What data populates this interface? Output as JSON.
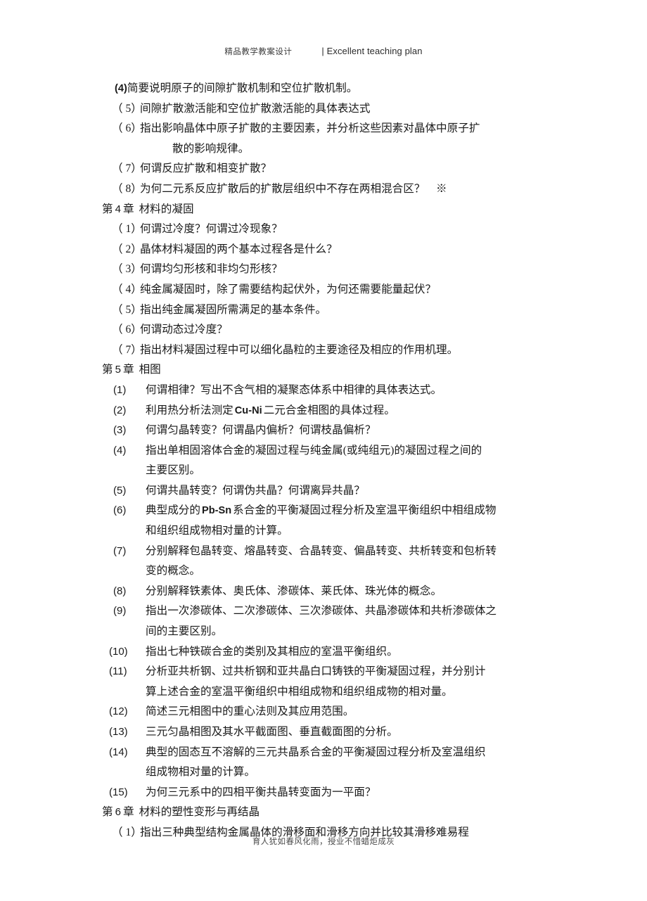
{
  "header": {
    "chinese": "精品教学教案设计",
    "separator_and_english": "| Excellent teaching plan"
  },
  "footer": {
    "motto": "育人犹如春风化雨，授业不惜蜡炬成灰"
  },
  "content": {
    "chapter3_tail": {
      "items": [
        {
          "marker": "(4)",
          "text": "简要说明原子的间隙扩散机制和空位扩散机制。"
        },
        {
          "marker": "（ 5）",
          "text": "间隙扩散激活能和空位扩散激活能的具体表达式"
        },
        {
          "marker": "（ 6）",
          "text": "指出影响晶体中原子扩散的主要因素，并分析这些因素对晶体中原子扩",
          "cont": "散的影响规律。"
        },
        {
          "marker": "（ 7）",
          "text": "何谓反应扩散和相变扩散？"
        },
        {
          "marker": "（ 8）",
          "text": "为何二元系反应扩散后的扩散层组织中不存在两相混合区？　※"
        }
      ]
    },
    "chapter4": {
      "prefix": "第",
      "number": "4",
      "suffix": "章",
      "title": "材料的凝固",
      "items": [
        {
          "marker": "（ 1）",
          "text": "何谓过冷度？何谓过冷现象？"
        },
        {
          "marker": "（ 2）",
          "text": "晶体材料凝固的两个基本过程各是什么？"
        },
        {
          "marker": "（ 3）",
          "text": "何谓均匀形核和非均匀形核？"
        },
        {
          "marker": "（ 4）",
          "text": "纯金属凝固时，除了需要结构起伏外，为何还需要能量起伏？"
        },
        {
          "marker": "（ 5）",
          "text": "指出纯金属凝固所需满足的基本条件。"
        },
        {
          "marker": "（ 6）",
          "text": "何谓动态过冷度？"
        },
        {
          "marker": "（ 7）",
          "text": "指出材料凝固过程中可以细化晶粒的主要途径及相应的作用机理。"
        }
      ]
    },
    "chapter5": {
      "prefix": "第",
      "number": "5",
      "suffix": "章",
      "title": "相图",
      "items": [
        {
          "marker": "(1)",
          "text": "何谓相律？写出不含气相的凝聚态体系中相律的具体表达式。"
        },
        {
          "marker": "(2)",
          "text_before": "利用热分析法测定",
          "latin": "Cu-Ni",
          "text_after": "二元合金相图的具体过程。"
        },
        {
          "marker": "(3)",
          "text": "何谓匀晶转变？何谓晶内偏析？何谓枝晶偏析？"
        },
        {
          "marker": "(4)",
          "text": "指出单相固溶体合金的凝固过程与纯金属(或纯组元)的凝固过程之间的",
          "cont": "主要区别。"
        },
        {
          "marker": "(5)",
          "text": "何谓共晶转变？何谓伪共晶？何谓离异共晶？"
        },
        {
          "marker": "(6)",
          "text_before": "典型成分的",
          "latin": "Pb-Sn",
          "text_after": "系合金的平衡凝固过程分析及室温平衡组织中相组成物",
          "cont": "和组织组成物相对量的计算。"
        },
        {
          "marker": "(7)",
          "text": "分别解释包晶转变、熔晶转变、合晶转变、偏晶转变、共析转变和包析转",
          "cont": "变的概念。"
        },
        {
          "marker": "(8)",
          "text": "分别解释铁素体、奥氏体、渗碳体、莱氏体、珠光体的概念。"
        },
        {
          "marker": "(9)",
          "text": "指出一次渗碳体、二次渗碳体、三次渗碳体、共晶渗碳体和共析渗碳体之",
          "cont": "间的主要区别。"
        },
        {
          "marker": "(10)",
          "text": "指出七种铁碳合金的类别及其相应的室温平衡组织。"
        },
        {
          "marker": "(11)",
          "text": "分析亚共析钢、过共析钢和亚共晶白口铸铁的平衡凝固过程，并分别计",
          "cont": "算上述合金的室温平衡组织中相组成物和组织组成物的相对量。"
        },
        {
          "marker": "(12)",
          "text": "简述三元相图中的重心法则及其应用范围。"
        },
        {
          "marker": "(13)",
          "text": "三元匀晶相图及其水平截面图、垂直截面图的分析。"
        },
        {
          "marker": "(14)",
          "text": "典型的固态互不溶解的三元共晶系合金的平衡凝固过程分析及室温组织",
          "cont": "组成物相对量的计算。"
        },
        {
          "marker": "(15)",
          "text": "为何三元系中的四相平衡共晶转变面为一平面？"
        }
      ]
    },
    "chapter6": {
      "prefix": "第",
      "number": "6",
      "suffix": "章",
      "title": "材料的塑性变形与再结晶",
      "items": [
        {
          "marker": "（ 1）",
          "text": "指出三种典型结构金属晶体的滑移面和滑移方向并比较其滑移难易程"
        }
      ]
    }
  }
}
